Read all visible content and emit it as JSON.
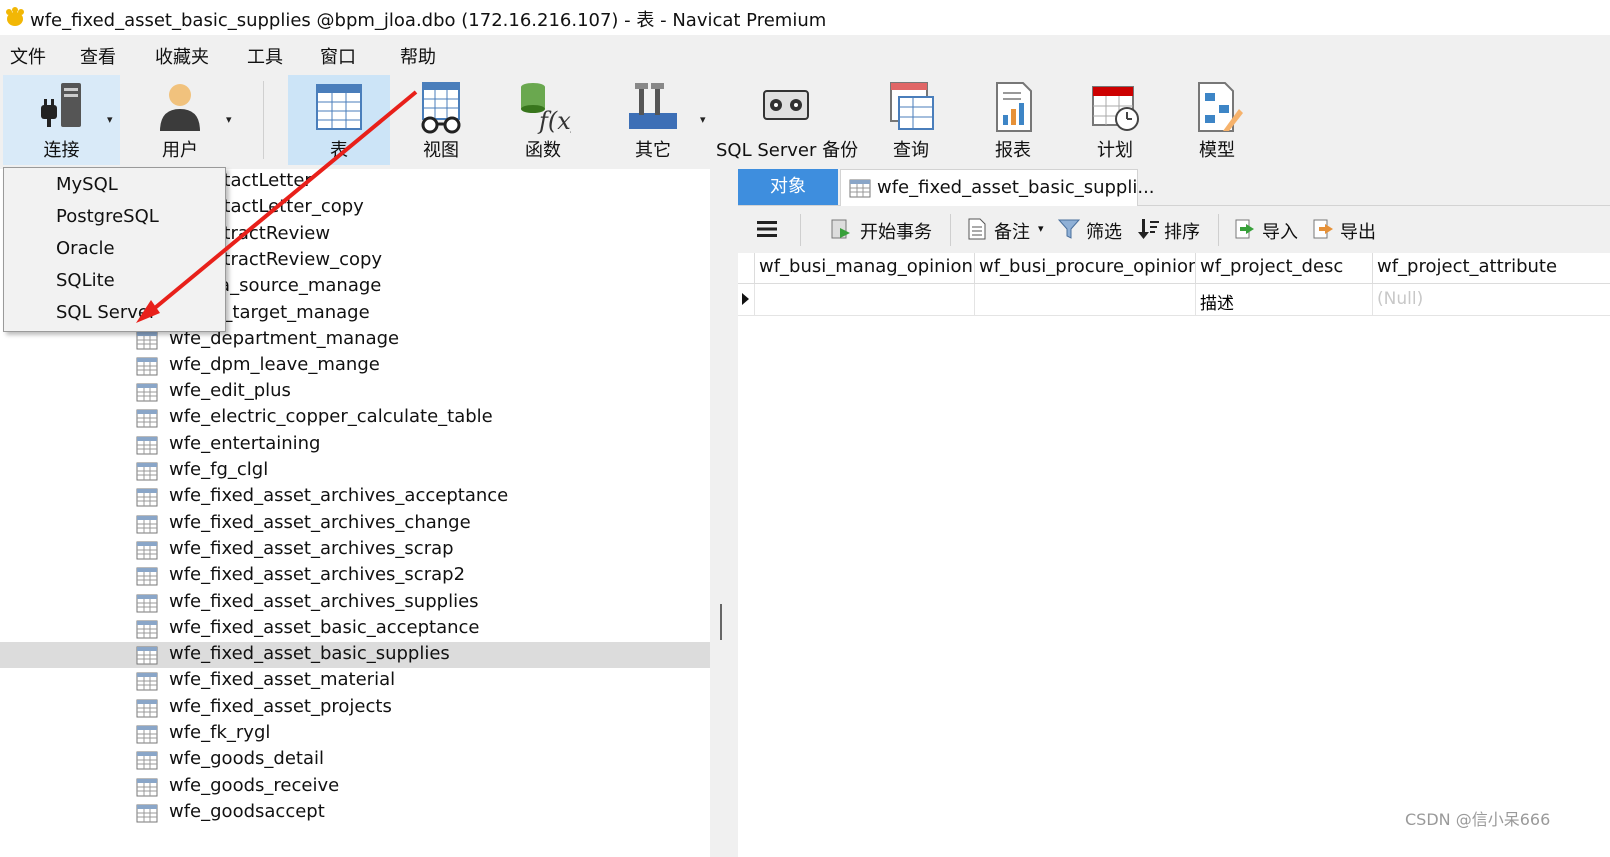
{
  "window": {
    "title": "wfe_fixed_asset_basic_supplies @bpm_jloa.dbo (172.16.216.107) - 表 - Navicat Premium"
  },
  "menu": [
    "文件",
    "查看",
    "收藏夹",
    "工具",
    "窗口",
    "帮助"
  ],
  "toolbar": {
    "connect": "连接",
    "user": "用户",
    "table": "表",
    "view": "视图",
    "function": "函数",
    "other": "其它",
    "backup": "SQL Server 备份",
    "query": "查询",
    "report": "报表",
    "schedule": "计划",
    "model": "模型"
  },
  "connection_menu": [
    "MySQL",
    "PostgreSQL",
    "Oracle",
    "SQLite",
    "SQL Server"
  ],
  "tree": {
    "partial_items": [
      "ntactLetter",
      "ntactLetter_copy",
      "ntractReview",
      "ntractReview_copy",
      "ta_source_manage",
      "p_target_manage"
    ],
    "items": [
      "wfe_department_manage",
      "wfe_dpm_leave_mange",
      "wfe_edit_plus",
      "wfe_electric_copper_calculate_table",
      "wfe_entertaining",
      "wfe_fg_clgl",
      "wfe_fixed_asset_archives_acceptance",
      "wfe_fixed_asset_archives_change",
      "wfe_fixed_asset_archives_scrap",
      "wfe_fixed_asset_archives_scrap2",
      "wfe_fixed_asset_archives_supplies",
      "wfe_fixed_asset_basic_acceptance",
      "wfe_fixed_asset_basic_supplies",
      "wfe_fixed_asset_material",
      "wfe_fixed_asset_projects",
      "wfe_fk_rygl",
      "wfe_goods_detail",
      "wfe_goods_receive",
      "wfe_goodsaccept"
    ],
    "selected": "wfe_fixed_asset_basic_supplies"
  },
  "tabs": {
    "objects": "对象",
    "table_tab": "wfe_fixed_asset_basic_suppli..."
  },
  "subtoolbar": {
    "begin_transaction": "开始事务",
    "note": "备注",
    "filter": "筛选",
    "sort": "排序",
    "import": "导入",
    "export": "导出"
  },
  "grid": {
    "columns": [
      "wf_busi_manag_opinion",
      "wf_busi_procure_opinion",
      "wf_project_desc",
      "wf_project_attribute"
    ],
    "rows": [
      [
        "",
        "",
        "描述",
        "(Null)"
      ]
    ]
  },
  "watermark": "CSDN @信小呆666",
  "colors": {
    "accent": "#3e8ede",
    "arrow": "#e8201a",
    "selected_row": "#dcdcdc",
    "active_tool": "#cce4f7"
  }
}
